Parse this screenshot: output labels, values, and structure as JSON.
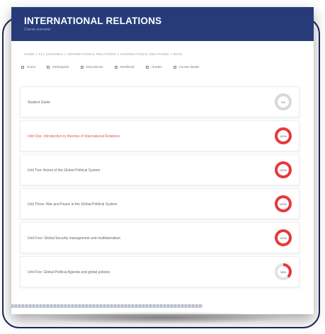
{
  "header": {
    "title": "INTERNATIONAL RELATIONS",
    "subtitle": "Course overview"
  },
  "breadcrumb": "HOME > ALL COURSES > INTERNATIONAL RELATIONS > INTERNATIONAL RELATIONS > MAIN",
  "tabs": [
    {
      "label": "Home"
    },
    {
      "label": "Participants"
    },
    {
      "label": "Discussions"
    },
    {
      "label": "Workbook"
    },
    {
      "label": "Grades"
    },
    {
      "label": "Course details"
    }
  ],
  "rows": [
    {
      "label": "Student Guide",
      "progress": "0%"
    },
    {
      "label": "Unit One: Introduction to theories of International Relations",
      "progress": "100%"
    },
    {
      "label": "Unit Two: Actors of the Global Political System",
      "progress": "100%"
    },
    {
      "label": "Unit Three: War and Peace in the Global Political System",
      "progress": "100%"
    },
    {
      "label": "Unit Four: Global Security management and multilateralism",
      "progress": "100%"
    },
    {
      "label": "Unit Five: Global Political Agenda and global policies",
      "progress": "38%"
    }
  ]
}
